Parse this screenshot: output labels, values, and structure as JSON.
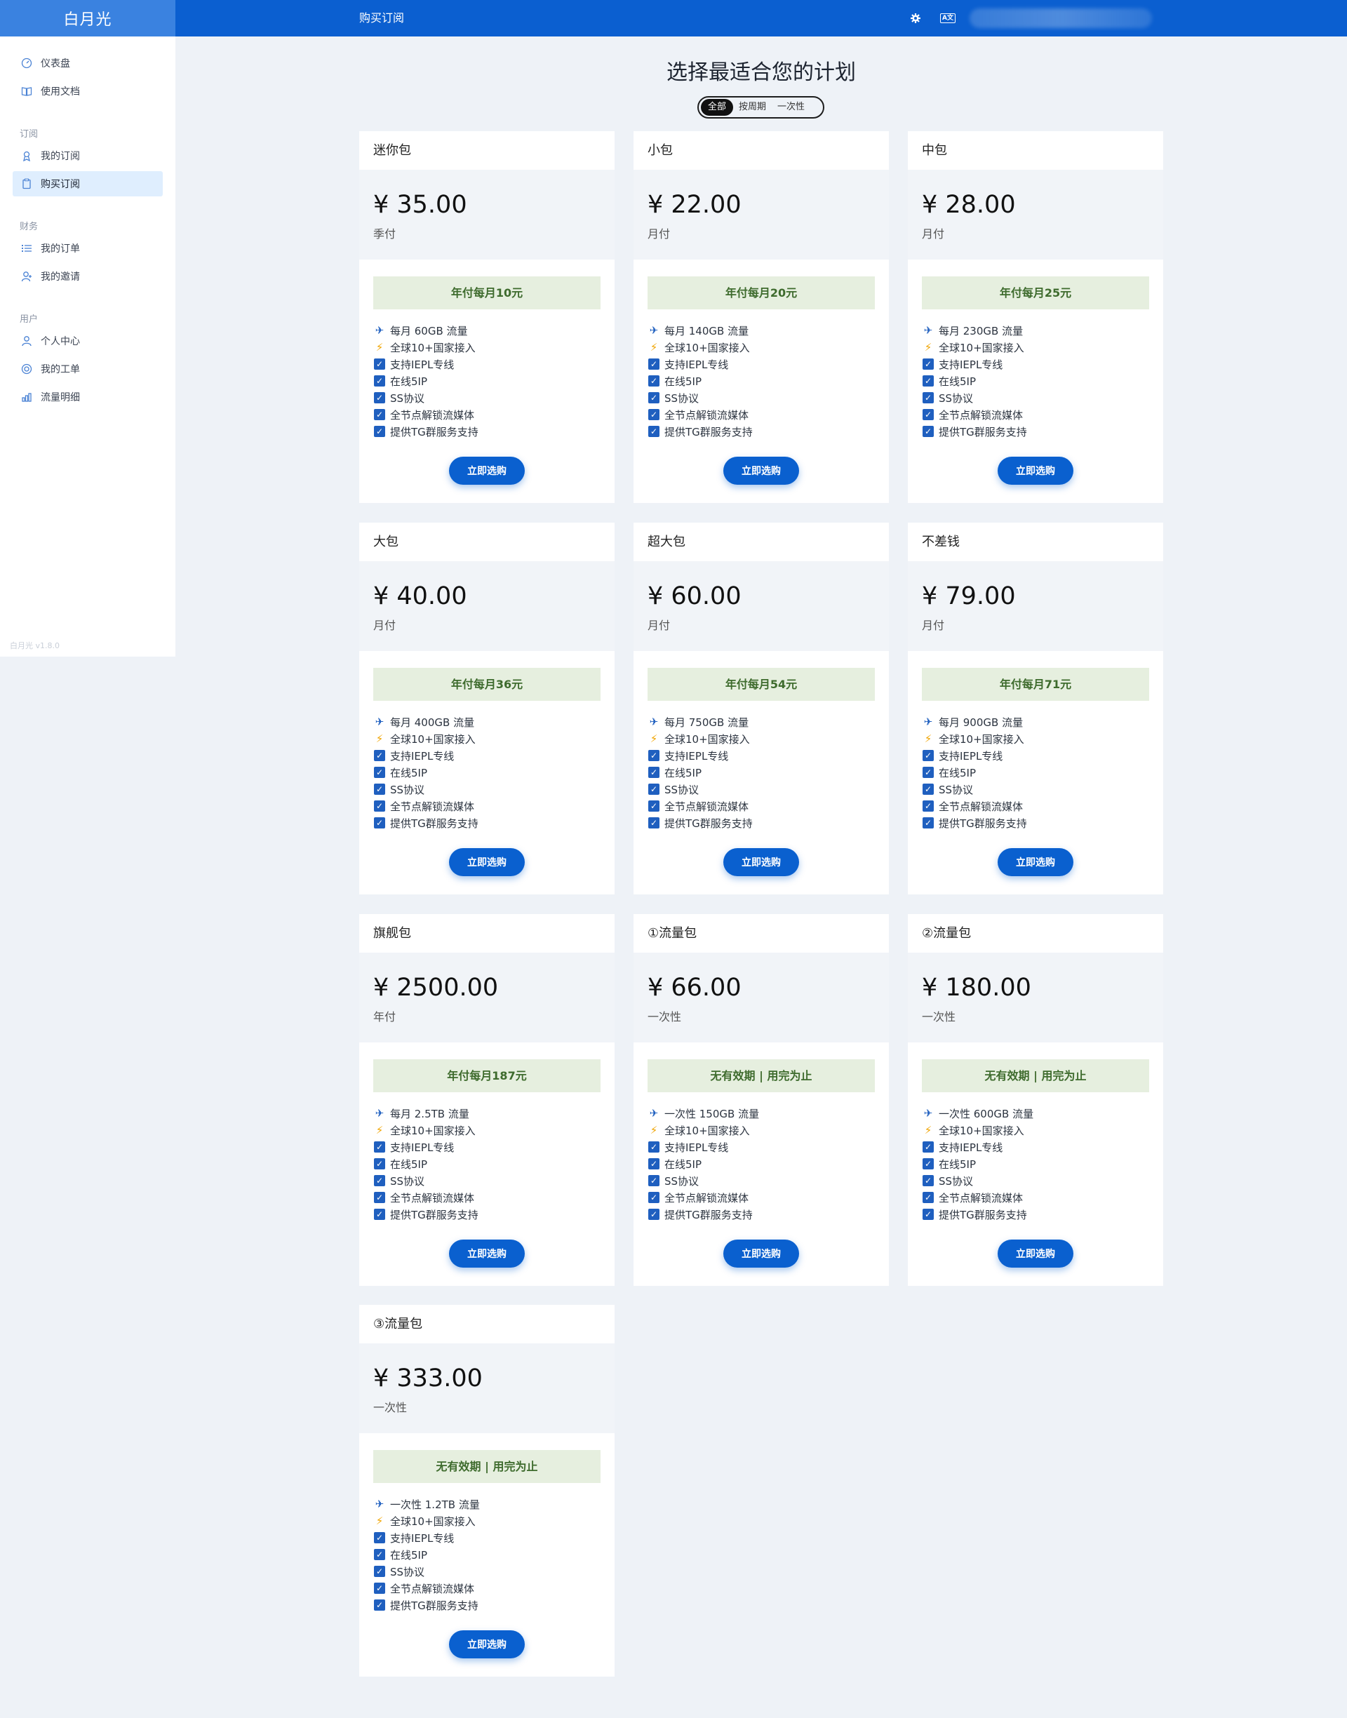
{
  "header": {
    "brand": "白月光",
    "page_title": "购买订阅",
    "settings_icon": "gear-icon",
    "language_icon": "language-icon",
    "language_glyph": "A文"
  },
  "sidebar": {
    "items": [
      {
        "label": "仪表盘",
        "icon": "dashboard-icon"
      },
      {
        "label": "使用文档",
        "icon": "book-icon"
      }
    ],
    "groups": [
      {
        "title": "订阅",
        "items": [
          {
            "label": "我的订阅",
            "icon": "subscription-icon"
          },
          {
            "label": "购买订阅",
            "icon": "clipboard-icon",
            "active": true
          }
        ]
      },
      {
        "title": "财务",
        "items": [
          {
            "label": "我的订单",
            "icon": "list-icon"
          },
          {
            "label": "我的邀请",
            "icon": "invite-icon"
          }
        ]
      },
      {
        "title": "用户",
        "items": [
          {
            "label": "个人中心",
            "icon": "user-icon"
          },
          {
            "label": "我的工单",
            "icon": "support-icon"
          },
          {
            "label": "流量明细",
            "icon": "chart-icon"
          }
        ]
      }
    ],
    "version": "白月光 v1.8.0"
  },
  "main": {
    "title": "选择最适合您的计划",
    "filters": [
      "全部",
      "按周期",
      "一次性"
    ],
    "active_filter": "全部",
    "buy_label": "立即选购"
  },
  "plans": [
    {
      "name": "迷你包",
      "price": "¥ 35.00",
      "period": "季付",
      "banner": "年付每月10元",
      "features": [
        "每月 60GB 流量",
        "全球10+国家接入",
        "支持IEPL专线",
        "在线5IP",
        "SS协议",
        "全节点解锁流媒体",
        "提供TG群服务支持"
      ]
    },
    {
      "name": "小包",
      "price": "¥ 22.00",
      "period": "月付",
      "banner": "年付每月20元",
      "features": [
        "每月 140GB 流量",
        "全球10+国家接入",
        "支持IEPL专线",
        "在线5IP",
        "SS协议",
        "全节点解锁流媒体",
        "提供TG群服务支持"
      ]
    },
    {
      "name": "中包",
      "price": "¥ 28.00",
      "period": "月付",
      "banner": "年付每月25元",
      "features": [
        "每月 230GB 流量",
        "全球10+国家接入",
        "支持IEPL专线",
        "在线5IP",
        "SS协议",
        "全节点解锁流媒体",
        "提供TG群服务支持"
      ]
    },
    {
      "name": "大包",
      "price": "¥ 40.00",
      "period": "月付",
      "banner": "年付每月36元",
      "features": [
        "每月 400GB 流量",
        "全球10+国家接入",
        "支持IEPL专线",
        "在线5IP",
        "SS协议",
        "全节点解锁流媒体",
        "提供TG群服务支持"
      ]
    },
    {
      "name": "超大包",
      "price": "¥ 60.00",
      "period": "月付",
      "banner": "年付每月54元",
      "features": [
        "每月 750GB 流量",
        "全球10+国家接入",
        "支持IEPL专线",
        "在线5IP",
        "SS协议",
        "全节点解锁流媒体",
        "提供TG群服务支持"
      ]
    },
    {
      "name": "不差钱",
      "price": "¥ 79.00",
      "period": "月付",
      "banner": "年付每月71元",
      "features": [
        "每月 900GB 流量",
        "全球10+国家接入",
        "支持IEPL专线",
        "在线5IP",
        "SS协议",
        "全节点解锁流媒体",
        "提供TG群服务支持"
      ]
    },
    {
      "name": "旗舰包",
      "price": "¥ 2500.00",
      "period": "年付",
      "banner": "年付每月187元",
      "features": [
        "每月 2.5TB 流量",
        "全球10+国家接入",
        "支持IEPL专线",
        "在线5IP",
        "SS协议",
        "全节点解锁流媒体",
        "提供TG群服务支持"
      ]
    },
    {
      "name": "①流量包",
      "price": "¥ 66.00",
      "period": "一次性",
      "banner": "无有效期 | 用完为止",
      "features": [
        "一次性 150GB 流量",
        "全球10+国家接入",
        "支持IEPL专线",
        "在线5IP",
        "SS协议",
        "全节点解锁流媒体",
        "提供TG群服务支持"
      ]
    },
    {
      "name": "②流量包",
      "price": "¥ 180.00",
      "period": "一次性",
      "banner": "无有效期 | 用完为止",
      "features": [
        "一次性 600GB 流量",
        "全球10+国家接入",
        "支持IEPL专线",
        "在线5IP",
        "SS协议",
        "全节点解锁流媒体",
        "提供TG群服务支持"
      ]
    },
    {
      "name": "③流量包",
      "price": "¥ 333.00",
      "period": "一次性",
      "banner": "无有效期 | 用完为止",
      "features": [
        "一次性 1.2TB 流量",
        "全球10+国家接入",
        "支持IEPL专线",
        "在线5IP",
        "SS协议",
        "全节点解锁流媒体",
        "提供TG群服务支持"
      ]
    }
  ],
  "feature_icons": [
    "plane-icon",
    "bolt-icon",
    "checkbox-icon",
    "checkbox-icon",
    "checkbox-icon",
    "checkbox-icon",
    "checkbox-icon"
  ],
  "colors": {
    "header": "#0b5fd0",
    "brand_bg": "#3a82e0",
    "buy_button": "#0a60cf",
    "banner_bg": "#e6efdf",
    "banner_text": "#3e6b2d",
    "active_nav": "#dfeefe"
  }
}
